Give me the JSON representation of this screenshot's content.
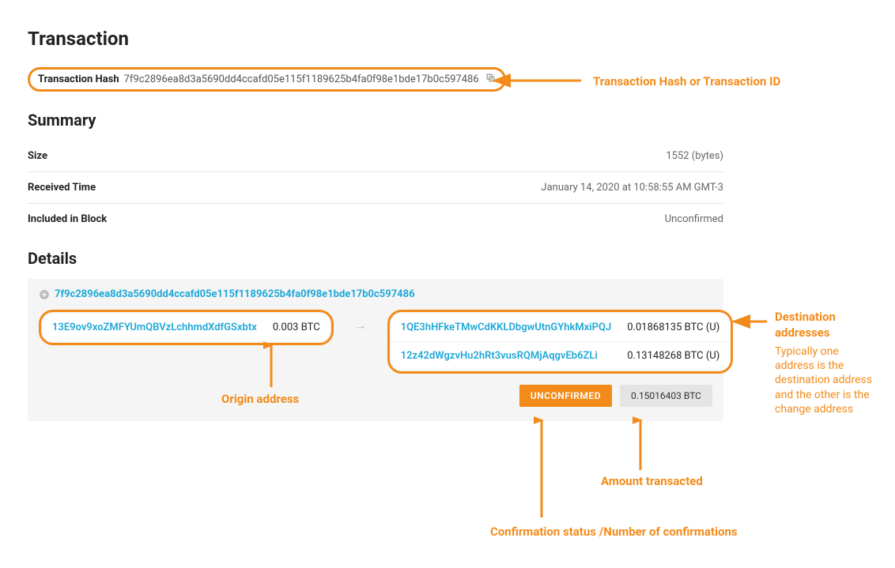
{
  "page_title": "Transaction",
  "tx_hash_label": "Transaction Hash",
  "tx_hash": "7f9c2896ea8d3a5690dd4ccafd05e115f1189625b4fa0f98e1bde17b0c597486",
  "summary_title": "Summary",
  "summary": {
    "size_label": "Size",
    "size_value": "1552 (bytes)",
    "received_label": "Received Time",
    "received_value": "January 14, 2020 at 10:58:55 AM GMT-3",
    "block_label": "Included in Block",
    "block_value": "Unconfirmed"
  },
  "details_title": "Details",
  "details_hash": "7f9c2896ea8d3a5690dd4ccafd05e115f1189625b4fa0f98e1bde17b0c597486",
  "input": {
    "address": "13E9ov9xoZMFYUmQBVzLchhmdXdfGSxbtx",
    "amount": "0.003 BTC"
  },
  "outputs": [
    {
      "address": "1QE3hHFkeTMwCdKKLDbgwUtnGYhkMxiPQJ",
      "amount": "0.01868135 BTC (U)"
    },
    {
      "address": "12z42dWgzvHu2hRt3vusRQMjAqgvEb6ZLi",
      "amount": "0.13148268 BTC (U)"
    }
  ],
  "status_badge": "UNCONFIRMED",
  "total_badge": "0.15016403 BTC",
  "annotations": {
    "tx_hash": "Transaction Hash or Transaction ID",
    "origin": "Origin address",
    "dest_title": "Destination addresses",
    "dest_sub": "Typically one address is the destination address and the other is the change address",
    "amount": "Amount transacted",
    "confirm": "Confirmation status /Number of confirmations"
  }
}
